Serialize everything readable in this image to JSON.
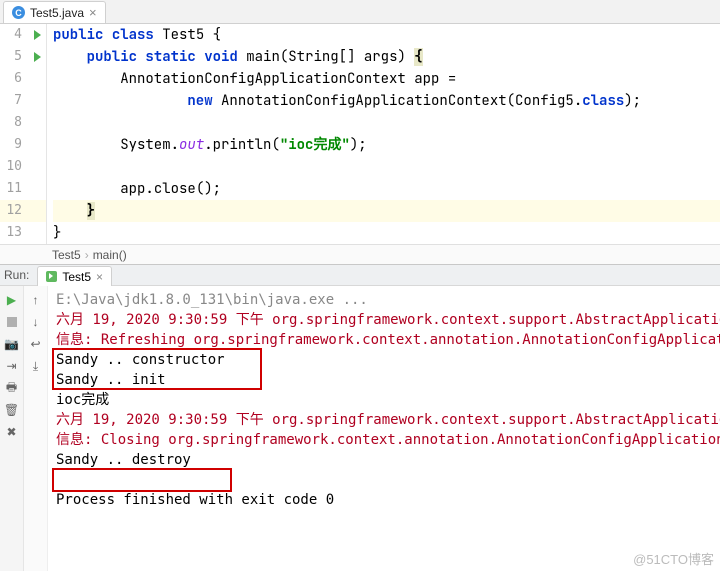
{
  "editor": {
    "tab": {
      "filename": "Test5.java",
      "icon_letter": "C"
    },
    "lines": [
      {
        "n": 4,
        "run": true,
        "hl": false
      },
      {
        "n": 5,
        "run": true,
        "hl": false
      },
      {
        "n": 6,
        "run": false,
        "hl": false
      },
      {
        "n": 7,
        "run": false,
        "hl": false
      },
      {
        "n": 8,
        "run": false,
        "hl": false
      },
      {
        "n": 9,
        "run": false,
        "hl": false
      },
      {
        "n": 10,
        "run": false,
        "hl": false
      },
      {
        "n": 11,
        "run": false,
        "hl": false
      },
      {
        "n": 12,
        "run": false,
        "hl": true
      },
      {
        "n": 13,
        "run": false,
        "hl": false
      }
    ],
    "tokens": {
      "kw_public": "public",
      "kw_class": "class",
      "kw_static": "static",
      "kw_void": "void",
      "kw_new": "new",
      "cls_test5": "Test5",
      "m_main": "main",
      "t_string": "String",
      "p_args": "args",
      "t_ctx": "AnnotationConfigApplicationContext",
      "v_app": "app",
      "t_cfg": "Config5",
      "kw_classlit": "class",
      "t_system": "System",
      "f_out": "out",
      "m_println": "println",
      "s_ioc": "\"ioc完成\"",
      "m_close": "close"
    },
    "breadcrumb": {
      "a": "Test5",
      "b": "main()"
    }
  },
  "run": {
    "label": "Run:",
    "tab": "Test5",
    "lines": {
      "cmd": "E:\\Java\\jdk1.8.0_131\\bin\\java.exe ...",
      "l1": "六月 19, 2020 9:30:59 下午 org.springframework.context.support.AbstractApplicatio",
      "l2": "信息: Refreshing org.springframework.context.annotation.AnnotationConfigApplicati",
      "l3": "Sandy .. constructor",
      "l4": "Sandy .. init",
      "l5": "ioc完成",
      "l6": "六月 19, 2020 9:30:59 下午 org.springframework.context.support.AbstractApplicatio",
      "l7": "信息: Closing org.springframework.context.annotation.AnnotationConfigApplicationC",
      "l8": "Sandy .. destroy",
      "exit": "Process finished with exit code 0"
    }
  },
  "watermark": "@51CTO博客"
}
